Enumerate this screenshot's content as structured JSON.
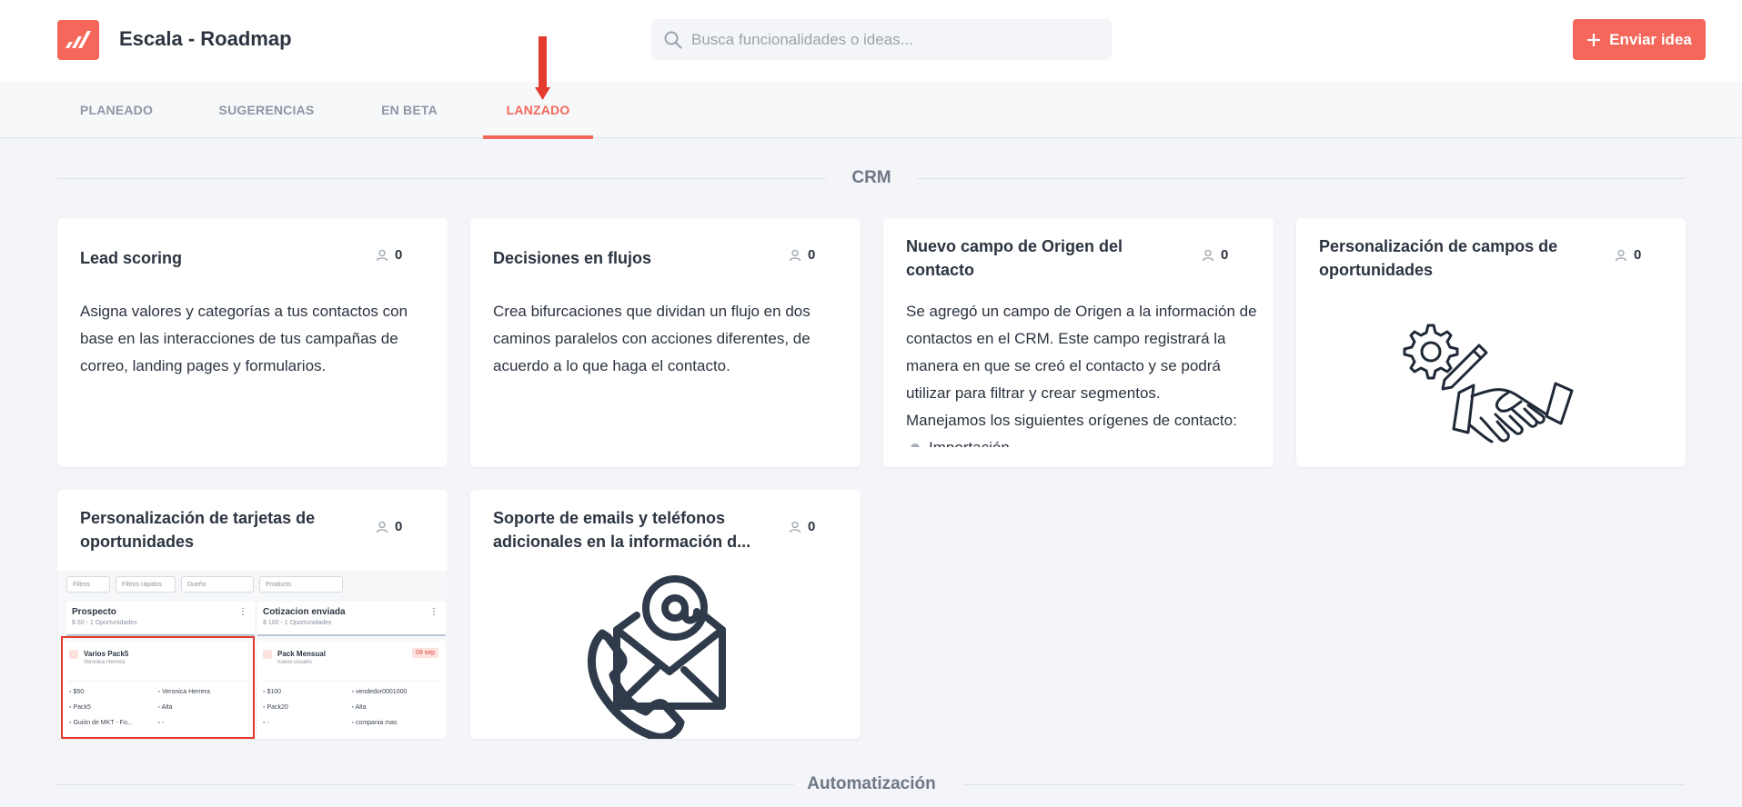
{
  "header": {
    "app_title": "Escala - Roadmap",
    "search_placeholder": "Busca funcionalidades o ideas...",
    "send_button": "Enviar idea",
    "brand_color": "#f4675a"
  },
  "tabs": [
    {
      "label": "PLANEADO",
      "active": false
    },
    {
      "label": "SUGERENCIAS",
      "active": false
    },
    {
      "label": "EN BETA",
      "active": false
    },
    {
      "label": "LANZADO",
      "active": true
    }
  ],
  "sections": [
    {
      "title": "CRM"
    },
    {
      "title": "Automatización"
    }
  ],
  "cards": [
    {
      "title": "Lead scoring",
      "votes": "0",
      "description": "Asigna valores y categorías a tus contactos con base en las interacciones de tus campañas de correo, landing pages y formularios."
    },
    {
      "title": "Decisiones en flujos",
      "votes": "0",
      "description": "Crea bifurcaciones que dividan un flujo en dos caminos paralelos con acciones diferentes, de acuerdo a lo que haga el contacto."
    },
    {
      "title": "Nuevo campo de Origen del contacto",
      "votes": "0",
      "description": "Se agregó un campo de Origen a la información de contactos en el CRM. Este campo registrará la manera en que se creó el contacto y se podrá utilizar para filtrar y crear segmentos.",
      "description2": "Manejamos los siguientes orígenes de contacto:",
      "bullet": "Importación"
    },
    {
      "title": "Personalización de campos de oportunidades",
      "votes": "0",
      "image_icon": "gear-pencil-handshake-illustration"
    },
    {
      "title": "Personalización de tarjetas de oportunidades",
      "votes": "0",
      "preview": {
        "filters": [
          "Filtros",
          "Filtros rápidos",
          "Dueño",
          "Producto"
        ],
        "columns": [
          {
            "name": "Prospecto",
            "sub": "$ 50 - 1 Oportunidades"
          },
          {
            "name": "Cotizacion enviada",
            "sub": "$ 100 - 1 Oportunidades"
          }
        ],
        "deals": [
          {
            "name": "Varios Pack5",
            "sub": "Veronica Herrera",
            "fields": [
              "$50",
              "Veronica Herrera",
              "Pack5",
              "Alta",
              "Guión de MKT - Fo...",
              "-"
            ]
          },
          {
            "name": "Pack Mensual",
            "sub": "nuevo usuario",
            "badge": "09 sep",
            "fields": [
              "$100",
              "vendedor0001000",
              "Pack20",
              "Alta",
              "-",
              "compania mas"
            ]
          }
        ]
      }
    },
    {
      "title": "Soporte de emails y teléfonos adicionales en la información d...",
      "votes": "0",
      "image_icon": "email-phone-illustration"
    }
  ]
}
